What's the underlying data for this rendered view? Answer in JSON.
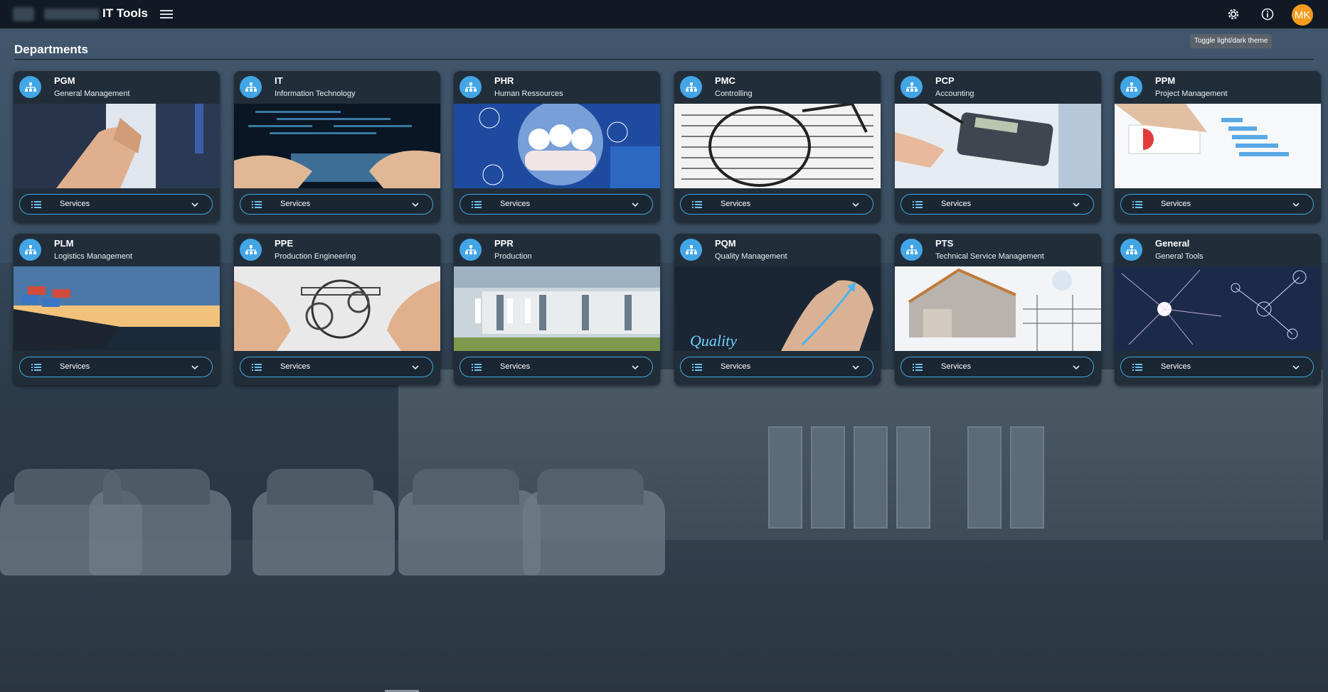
{
  "header": {
    "app_title": "IT Tools",
    "menu_icon": "hamburger-menu-icon",
    "theme_icon": "gear-icon",
    "info_icon": "info-icon",
    "avatar_initials": "MK",
    "avatar_color": "#f59b1e",
    "tooltip": "Toggle light/dark theme"
  },
  "main": {
    "section_title": "Departments",
    "cards": [
      {
        "code": "PGM",
        "name": "General Management",
        "button": "Services",
        "image": "handshake"
      },
      {
        "code": "IT",
        "name": "Information Technology",
        "button": "Services",
        "image": "keyboard-code"
      },
      {
        "code": "PHR",
        "name": "Human Ressources",
        "button": "Services",
        "image": "people-bubble"
      },
      {
        "code": "PMC",
        "name": "Controlling",
        "button": "Services",
        "image": "glasses-numbers"
      },
      {
        "code": "PCP",
        "name": "Accounting",
        "button": "Services",
        "image": "calculator"
      },
      {
        "code": "PPM",
        "name": "Project Management",
        "button": "Services",
        "image": "report-charts"
      },
      {
        "code": "PLM",
        "name": "Logistics Management",
        "button": "Services",
        "image": "cargo-ship"
      },
      {
        "code": "PPE",
        "name": "Production Engineering",
        "button": "Services",
        "image": "engine-hands"
      },
      {
        "code": "PPR",
        "name": "Production",
        "button": "Services",
        "image": "factory-line"
      },
      {
        "code": "PQM",
        "name": "Quality Management",
        "button": "Services",
        "image": "quality-hand",
        "image_text": "Quality"
      },
      {
        "code": "PTS",
        "name": "Technical Service Management",
        "button": "Services",
        "image": "house-construction"
      },
      {
        "code": "General",
        "name": "General Tools",
        "button": "Services",
        "image": "network-nodes"
      }
    ]
  },
  "colors": {
    "accent": "#42a5e6",
    "card_bg": "#212e3a",
    "topbar_bg": "#111a24",
    "button_border": "#3ea7de"
  }
}
